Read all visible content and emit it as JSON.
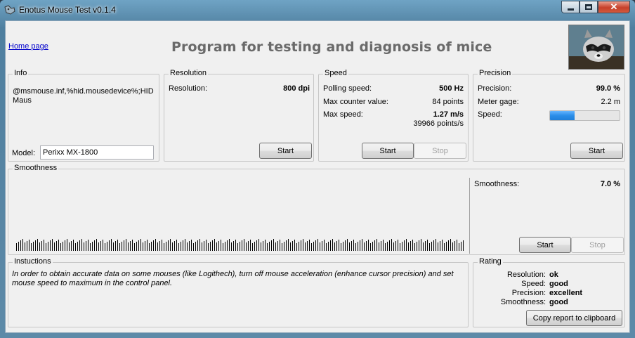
{
  "window": {
    "title": "Enotus Mouse Test v0.1.4"
  },
  "header": {
    "home_link": "Home page",
    "heading": "Program for testing and diagnosis of mice"
  },
  "info": {
    "legend": "Info",
    "device": "@msmouse.inf,%hid.mousedevice%;HID Maus",
    "model_label": "Model:",
    "model_value": "Perixx MX-1800"
  },
  "resolution": {
    "legend": "Resolution",
    "label": "Resolution:",
    "value": "800 dpi",
    "start_label": "Start"
  },
  "speed": {
    "legend": "Speed",
    "polling_label": "Polling speed:",
    "polling_value": "500 Hz",
    "counter_label": "Max counter value:",
    "counter_value": "84 points",
    "max_label": "Max  speed:",
    "max_value": "1.27 m/s",
    "max_points": "39966 points/s",
    "start_label": "Start",
    "stop_label": "Stop"
  },
  "precision": {
    "legend": "Precision",
    "precision_label": "Precision:",
    "precision_value": "99.0 %",
    "meter_label": "Meter gage:",
    "meter_value": "2.2 m",
    "speed_label": "Speed:",
    "speed_level": 0.35,
    "start_label": "Start"
  },
  "smoothness": {
    "legend": "Smoothness",
    "label": "Smoothness:",
    "value": "7.0 %",
    "start_label": "Start",
    "stop_label": "Stop"
  },
  "instructions": {
    "legend": "Instuctions",
    "text": "In order to obtain accurate data on some mouses (like Logithech), turn off mouse acceleration (enhance cursor precision) and set mouse speed to maximum in the control panel."
  },
  "rating": {
    "legend": "Rating",
    "items": [
      {
        "label": "Resolution:",
        "value": "ok"
      },
      {
        "label": "Speed:",
        "value": "good"
      },
      {
        "label": "Precision:",
        "value": "excellent"
      },
      {
        "label": "Smoothness:",
        "value": "good"
      }
    ],
    "copy_label": "Copy report to clipboard"
  },
  "colors": {
    "accent": "#2a8de8",
    "heading": "#6a6a6a",
    "link": "#0000cc"
  }
}
